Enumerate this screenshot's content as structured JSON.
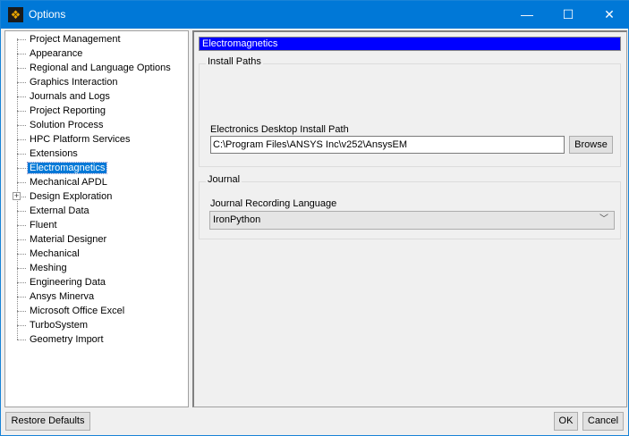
{
  "window": {
    "title": "Options",
    "minimize": "—",
    "maximize": "☐",
    "close": "✕",
    "accent": "#0078d7"
  },
  "tree": {
    "items": [
      {
        "label": "Project Management"
      },
      {
        "label": "Appearance"
      },
      {
        "label": "Regional and Language Options"
      },
      {
        "label": "Graphics Interaction"
      },
      {
        "label": "Journals and Logs"
      },
      {
        "label": "Project Reporting"
      },
      {
        "label": "Solution Process"
      },
      {
        "label": "HPC Platform Services"
      },
      {
        "label": "Extensions"
      },
      {
        "label": "Electromagnetics",
        "selected": true
      },
      {
        "label": "Mechanical APDL"
      },
      {
        "label": "Design Exploration",
        "expandable": true
      },
      {
        "label": "External Data"
      },
      {
        "label": "Fluent"
      },
      {
        "label": "Material Designer"
      },
      {
        "label": "Mechanical"
      },
      {
        "label": "Meshing"
      },
      {
        "label": "Engineering Data"
      },
      {
        "label": "Ansys Minerva"
      },
      {
        "label": "Microsoft Office Excel"
      },
      {
        "label": "TurboSystem"
      },
      {
        "label": "Geometry Import"
      }
    ]
  },
  "panel": {
    "header": "Electromagnetics",
    "install_paths": {
      "legend": "Install Paths",
      "field_label": "Electronics Desktop Install Path",
      "value": "C:\\Program Files\\ANSYS Inc\\v252\\AnsysEM",
      "browse": "Browse"
    },
    "journal": {
      "legend": "Journal",
      "field_label": "Journal Recording Language",
      "selected": "IronPython"
    }
  },
  "footer": {
    "restore": "Restore Defaults",
    "ok": "OK",
    "cancel": "Cancel"
  }
}
